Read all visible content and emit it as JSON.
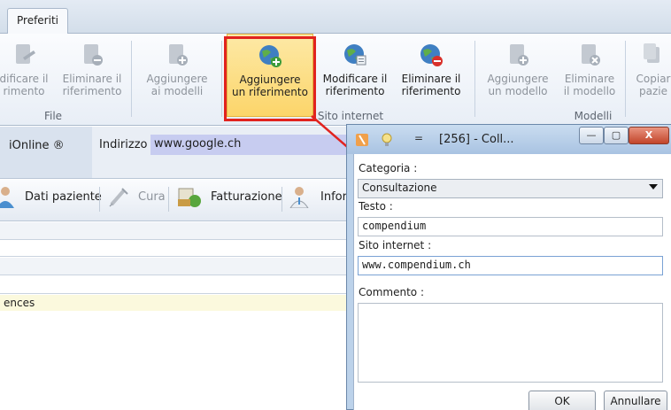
{
  "ribbon": {
    "tab": "Preferiti",
    "buttons": [
      {
        "line1": "dificare il",
        "line2": "rimento",
        "disabled": true
      },
      {
        "line1": "Eliminare il",
        "line2": "riferimento",
        "disabled": true
      },
      {
        "line1": "Aggiungere",
        "line2": "ai modelli",
        "disabled": true
      },
      {
        "line1": "Aggiungere",
        "line2": "un riferimento",
        "disabled": false,
        "highlighted": true
      },
      {
        "line1": "Modificare il",
        "line2": "riferimento",
        "disabled": false
      },
      {
        "line1": "Eliminare il",
        "line2": "riferimento",
        "disabled": false
      },
      {
        "line1": "Aggiungere",
        "line2": "un modello",
        "disabled": true
      },
      {
        "line1": "Eliminare",
        "line2": "il modello",
        "disabled": true
      },
      {
        "line1": "Copiar",
        "line2": "pazie",
        "disabled": true
      }
    ],
    "groups": [
      "File",
      "Sito internet",
      "Modelli"
    ]
  },
  "toolbar": {
    "online_tab": "iOnline ®",
    "address_label": "Indirizzo",
    "address_value": "www.google.ch"
  },
  "nav": {
    "items": [
      {
        "label": "Dati paziente",
        "disabled": false
      },
      {
        "label": "Cura",
        "disabled": true
      },
      {
        "label": "Fatturazione",
        "disabled": false
      },
      {
        "label": "Infor",
        "disabled": false
      }
    ]
  },
  "content": {
    "row_text": "ences"
  },
  "dialog": {
    "title": "[256] - Coll...",
    "title_glyph": "=",
    "window_buttons": {
      "minimize": "—",
      "maximize": "▢",
      "close": "X"
    },
    "fields": {
      "categoria_label": "Categoria :",
      "categoria_value": "Consultazione",
      "testo_label": "Testo :",
      "testo_value": "compendium",
      "sito_label": "Sito internet :",
      "sito_value": "www.compendium.ch",
      "commento_label": "Commento :",
      "commento_value": ""
    },
    "ok_label": "OK",
    "cancel_label": "Annullare"
  },
  "colors": {
    "highlight_border": "#e1231f",
    "selected_button": "#fcd56a",
    "address_highlight": "#c7ccf0"
  }
}
